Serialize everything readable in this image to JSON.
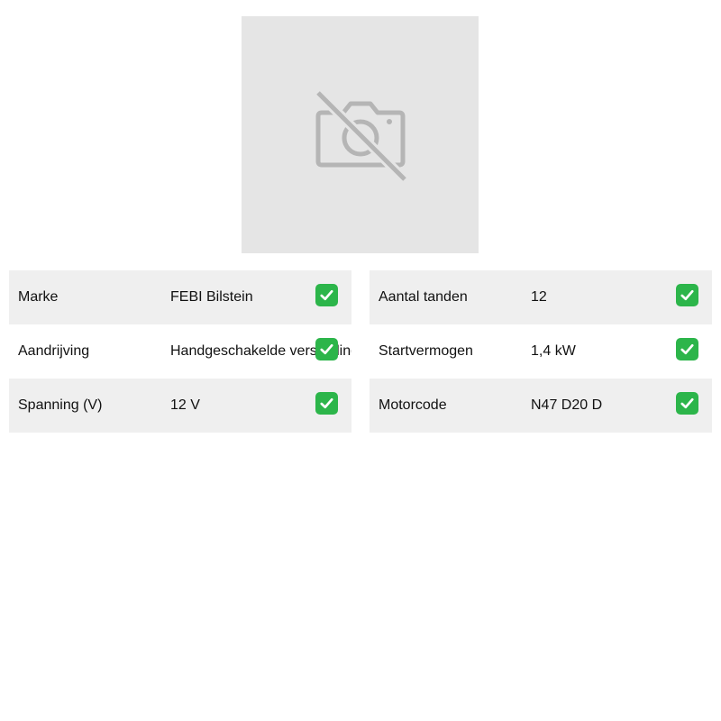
{
  "product_image": {
    "icon": "no-photo-icon"
  },
  "specs_left": [
    {
      "label": "Marke",
      "value": "FEBI Bilstein",
      "icon": "check-icon"
    },
    {
      "label": "Aandrijving",
      "value": "Handgeschakelde versnelling",
      "icon": "check-icon"
    },
    {
      "label": "Spanning (V)",
      "value": "12 V",
      "icon": "check-icon"
    }
  ],
  "specs_right": [
    {
      "label": "Aantal tanden",
      "value": "12",
      "icon": "check-icon"
    },
    {
      "label": "Startvermogen",
      "value": "1,4 kW",
      "icon": "check-icon"
    },
    {
      "label": "Motorcode",
      "value": "N47 D20 D",
      "icon": "check-icon"
    }
  ],
  "colors": {
    "row_shade": "#efefef",
    "placeholder_bg": "#e5e5e5",
    "check_green": "#2cb54a"
  }
}
